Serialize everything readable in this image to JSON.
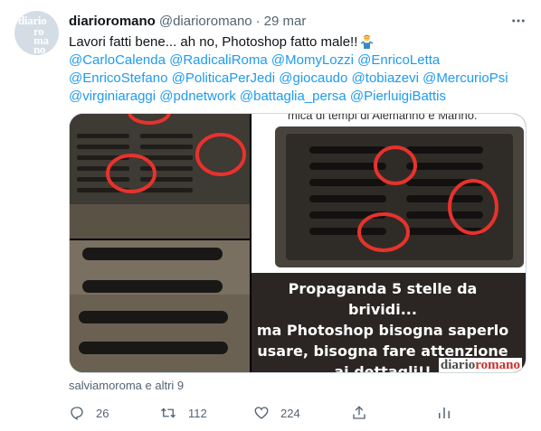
{
  "tweet": {
    "avatar": {
      "label": "diarioromano logo avatar",
      "letters": [
        "diario",
        "ro",
        "ma",
        "no"
      ]
    },
    "display_name": "diarioromano",
    "handle": "@diarioromano",
    "separator": "·",
    "date": "29 mar",
    "text_line_1": "Lavori fatti bene... ah no, Photoshop fatto male!!",
    "emoji": "man-shrugging-emoji",
    "mentions_line_1": [
      "@CarloCalenda",
      "@RadicaliRoma",
      "@MomyLozzi",
      "@EnricoLetta"
    ],
    "mentions_line_2": [
      "@EnricoStefano",
      "@PoliticaPerJedi",
      "@giocaudo",
      "@tobiazevi",
      "@MercurioPsi"
    ],
    "mentions_line_3": [
      "@virginiaraggi",
      "@pdnetwork",
      "@battaglia_persa",
      "@PierluigiBattis"
    ],
    "media": {
      "top_caption_fragment": "mica di tempi di Alemanno e Marino.",
      "overlay_text": [
        "Propaganda 5 stelle da brividi...",
        "ma Photoshop bisogna saperlo",
        "usare, bisogna fare attenzione",
        "ai dettagli!!"
      ],
      "watermark_part_1": "diario",
      "watermark_part_2": "romano"
    },
    "tagged": "salviamoroma e altri 9",
    "actions": {
      "reply_count": "26",
      "retweet_count": "112",
      "like_count": "224"
    }
  },
  "colors": {
    "accent": "#1d9bf0",
    "secondary_text": "#536471",
    "circle_red": "#e8322c"
  },
  "icons": [
    "more-icon",
    "reply-icon",
    "retweet-icon",
    "like-icon",
    "share-icon",
    "analytics-icon"
  ]
}
